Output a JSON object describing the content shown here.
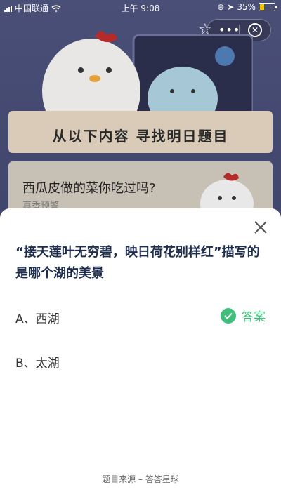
{
  "status_bar": {
    "carrier": "中国联通",
    "time": "上午 9:08",
    "battery_text": "35%",
    "battery_level": 0.35
  },
  "header": {
    "banner_text": "从以下内容 寻找明日题目"
  },
  "background_card": {
    "question": "西瓜皮做的菜你吃过吗?",
    "subtitle": "真香预警"
  },
  "quiz": {
    "question": "“接天莲叶无穷碧，映日荷花别样红”描写的是哪个湖的美景",
    "options": [
      {
        "label": "A、西湖"
      },
      {
        "label": "B、太湖"
      }
    ],
    "answer_label": "答案",
    "source_text": "题目来源 – 答答星球"
  },
  "colors": {
    "accent_green": "#3fbf7a",
    "question_text": "#1f2d4d"
  }
}
